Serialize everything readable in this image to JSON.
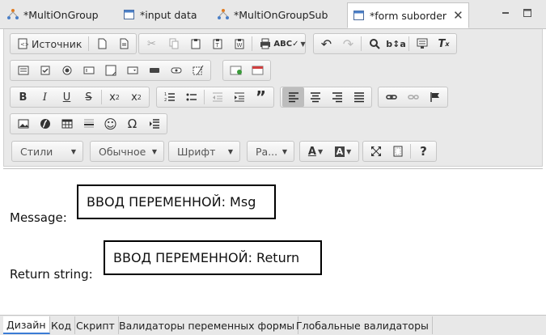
{
  "editor_tabs": [
    {
      "label": "*MultiOnGroup",
      "icon": "workflow-graph-icon"
    },
    {
      "label": "*input data",
      "icon": "form-icon"
    },
    {
      "label": "*MultiOnGroupSub",
      "icon": "workflow-graph-icon"
    },
    {
      "label": "*form suborder",
      "icon": "form-icon",
      "active": true
    }
  ],
  "toolbar": {
    "source_label": "Источник",
    "styles_combo": "Стили",
    "format_combo": "Обычное",
    "font_combo": "Шрифт",
    "size_combo": "Ра..."
  },
  "form": {
    "message_label": "Message:",
    "message_field": "ВВОД ПЕРЕМЕННОЙ: Msg",
    "return_label": "Return string:",
    "return_field": "ВВОД ПЕРЕМЕННОЙ: Return"
  },
  "bottom_tabs": [
    "Дизайн",
    "Код",
    "Скрипт",
    "Валидаторы переменных формы",
    "Глобальные валидаторы"
  ],
  "colors": {
    "active_tab_underline": "#3a7bd5",
    "graph_icon_orange": "#e07b20",
    "graph_icon_blue": "#4a7fc8"
  }
}
